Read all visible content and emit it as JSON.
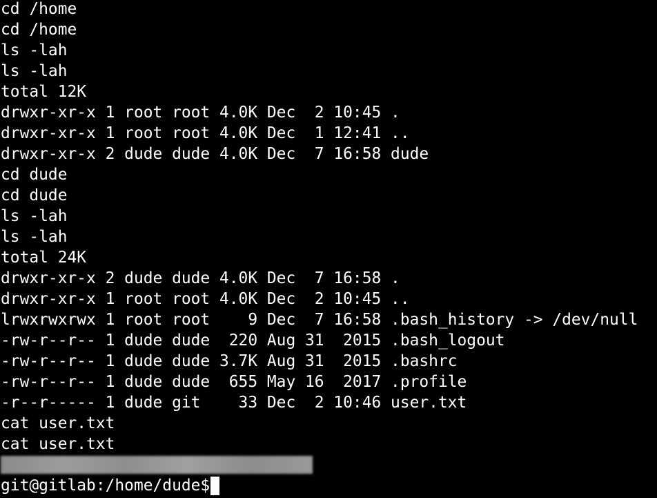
{
  "terminal": {
    "lines": [
      "cd /home",
      "cd /home",
      "ls -lah",
      "ls -lah",
      "total 12K",
      "drwxr-xr-x 1 root root 4.0K Dec  2 10:45 .",
      "drwxr-xr-x 1 root root 4.0K Dec  1 12:41 ..",
      "drwxr-xr-x 2 dude dude 4.0K Dec  7 16:58 dude",
      "cd dude",
      "cd dude",
      "ls -lah",
      "ls -lah",
      "total 24K",
      "drwxr-xr-x 2 dude dude 4.0K Dec  7 16:58 .",
      "drwxr-xr-x 1 root root 4.0K Dec  2 10:45 ..",
      "lrwxrwxrwx 1 root root    9 Dec  7 16:58 .bash_history -> /dev/null",
      "-rw-r--r-- 1 dude dude  220 Aug 31  2015 .bash_logout",
      "-rw-r--r-- 1 dude dude 3.7K Aug 31  2015 .bashrc",
      "-rw-r--r-- 1 dude dude  655 May 16  2017 .profile",
      "-r--r----- 1 dude git    33 Dec  2 10:46 user.txt",
      "cat user.txt",
      "cat user.txt"
    ],
    "prompt": "git@gitlab:/home/dude$",
    "colors": {
      "background": "#000000",
      "foreground": "#ffffff"
    }
  }
}
